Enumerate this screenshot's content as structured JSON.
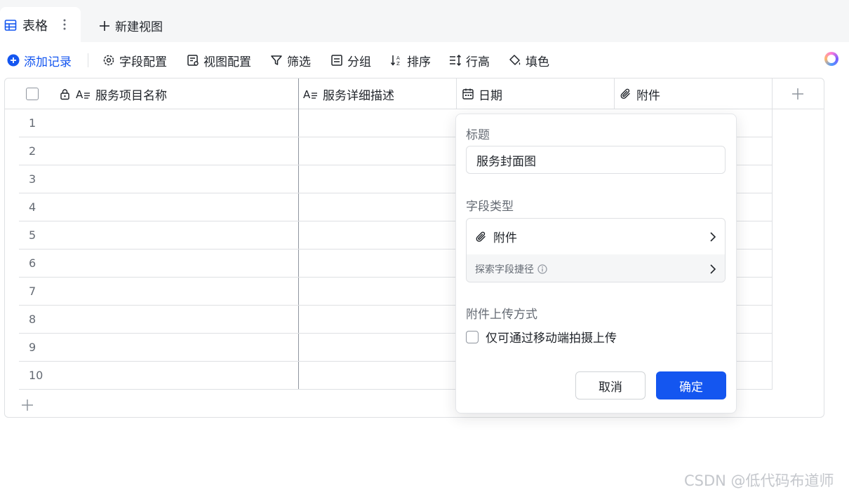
{
  "tabs": {
    "active_label": "表格",
    "new_view_label": "新建视图"
  },
  "toolbar": {
    "add_record": "添加记录",
    "field_config": "字段配置",
    "view_config": "视图配置",
    "filter": "筛选",
    "group": "分组",
    "sort": "排序",
    "row_height": "行高",
    "fill_color": "填色"
  },
  "grid": {
    "columns": [
      {
        "label": "服务项目名称",
        "icon": "text-icon",
        "locked": true
      },
      {
        "label": "服务详细描述",
        "icon": "text-icon"
      },
      {
        "label": "日期",
        "icon": "calendar-icon"
      },
      {
        "label": "附件",
        "icon": "attachment-icon"
      }
    ],
    "row_numbers": [
      "1",
      "2",
      "3",
      "4",
      "5",
      "6",
      "7",
      "8",
      "9",
      "10"
    ]
  },
  "popup": {
    "title_label": "标题",
    "title_value": "服务封面图",
    "field_type_label": "字段类型",
    "field_type_value": "附件",
    "explore_shortcut": "探索字段捷径",
    "upload_label": "附件上传方式",
    "mobile_only": "仅可通过移动端拍摄上传",
    "cancel": "取消",
    "confirm": "确定"
  },
  "watermark": "CSDN @低代码布道师",
  "colors": {
    "accent": "#1456f0",
    "border": "#dee0e3",
    "muted_text": "#646a73"
  }
}
